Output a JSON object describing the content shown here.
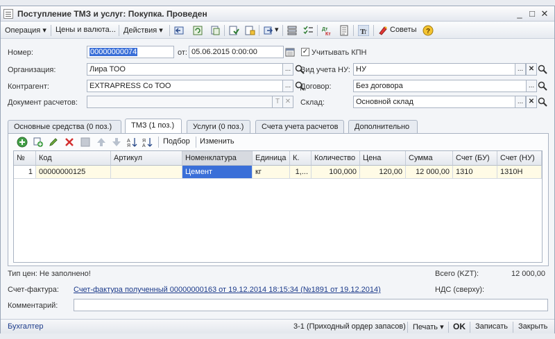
{
  "window": {
    "title": "Поступление ТМЗ и услуг: Покупка. Проведен",
    "minimize": "_",
    "maximize": "□",
    "close": "✕"
  },
  "toolbar": {
    "operation": "Операция ▾",
    "prices": "Цены и валюта...",
    "actions": "Действия ▾",
    "tips": "Советы"
  },
  "form": {
    "number_label": "Номер:",
    "number_value": "00000000074",
    "date_label": "от:",
    "date_value": "05.06.2015  0:00:00",
    "kpn_label": "Учитывать КПН",
    "kpn_checked": "✓",
    "org_label": "Организация:",
    "org_value": "Лира ТОО",
    "nu_label": "Вид учета НУ:",
    "nu_value": "НУ",
    "contractor_label": "Контрагент:",
    "contractor_value": "EXTRAPRESS Co  ТОО",
    "contract_label": "Договор:",
    "contract_value": "Без договора",
    "settle_doc_label": "Документ расчетов:",
    "settle_doc_value": "",
    "warehouse_label": "Склад:",
    "warehouse_value": "Основной склад"
  },
  "tabs": [
    {
      "label": "Основные средства (0 поз.)"
    },
    {
      "label": "ТМЗ (1 поз.)"
    },
    {
      "label": "Услуги (0 поз.)"
    },
    {
      "label": "Счета учета расчетов"
    },
    {
      "label": "Дополнительно"
    }
  ],
  "panel_toolbar": {
    "pick": "Подбор",
    "change": "Изменить"
  },
  "table": {
    "headers": [
      "№",
      "Код",
      "Артикул",
      "Номенклатура",
      "Единица",
      "К.",
      "Количество",
      "Цена",
      "Сумма",
      "Счет (БУ)",
      "Счет (НУ)"
    ],
    "rows": [
      [
        "1",
        "00000000125",
        "",
        "Цемент",
        "кг",
        "1,...",
        "100,000",
        "120,00",
        "12 000,00",
        "1310",
        "1310Н"
      ]
    ]
  },
  "footer": {
    "price_type": "Тип цен: Не заполнено!",
    "total_label": "Всего (KZT):",
    "total_value": "12 000,00",
    "invoice_label": "Счет-фактура:",
    "invoice_link": "Счет-фактура полученный 00000000163 от 19.12.2014 18:15:34 (№1891 от 19.12.2014)",
    "vat_label": "НДС (сверху):",
    "comment_label": "Комментарий:",
    "comment_value": ""
  },
  "statusbar": {
    "left": "Бухгалтер",
    "order": "3-1 (Приходный ордер запасов)",
    "print": "Печать ▾",
    "ok": "OK",
    "save": "Записать",
    "close": "Закрыть"
  },
  "colors": {
    "accent": "#3a6fd8",
    "link": "#1b3a8a",
    "row_bg": "#fffbe6"
  }
}
